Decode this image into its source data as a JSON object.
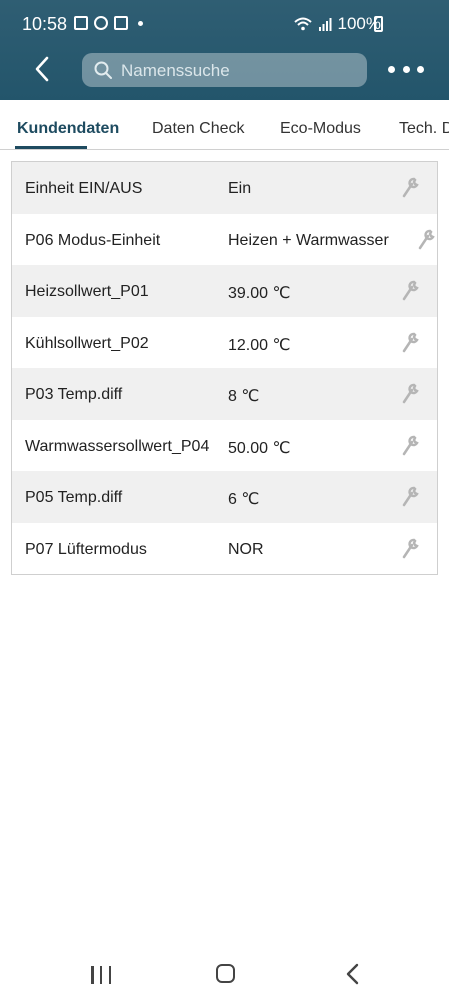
{
  "status_bar": {
    "time": "10:58",
    "battery": "100%",
    "icons": [
      "image-icon",
      "sync-icon",
      "app-icon",
      "wifi-icon",
      "signal-icon",
      "battery-charging-icon"
    ]
  },
  "header": {
    "search_placeholder": "Namenssuche",
    "colors": {
      "background": "#2a5b70",
      "accent": "#1e4b60"
    }
  },
  "tabs": [
    {
      "label": "Kundendaten",
      "active": true
    },
    {
      "label": "Daten Check",
      "active": false
    },
    {
      "label": "Eco-Modus",
      "active": false
    },
    {
      "label": "Tech. D",
      "active": false
    }
  ],
  "parameters": [
    {
      "label": "Einheit EIN/AUS",
      "value": "Ein"
    },
    {
      "label": "P06 Modus-Einheit",
      "value": "Heizen + Warmwasser"
    },
    {
      "label": "Heizsollwert_P01",
      "value": "39.00 ℃"
    },
    {
      "label": "Kühlsollwert_P02",
      "value": "12.00 ℃"
    },
    {
      "label": "P03 Temp.diff",
      "value": "8 ℃"
    },
    {
      "label": "Warmwassersollwert_P04",
      "value": "50.00 ℃"
    },
    {
      "label": "P05 Temp.diff",
      "value": "6 ℃"
    },
    {
      "label": "P07 Lüftermodus",
      "value": "NOR"
    }
  ]
}
